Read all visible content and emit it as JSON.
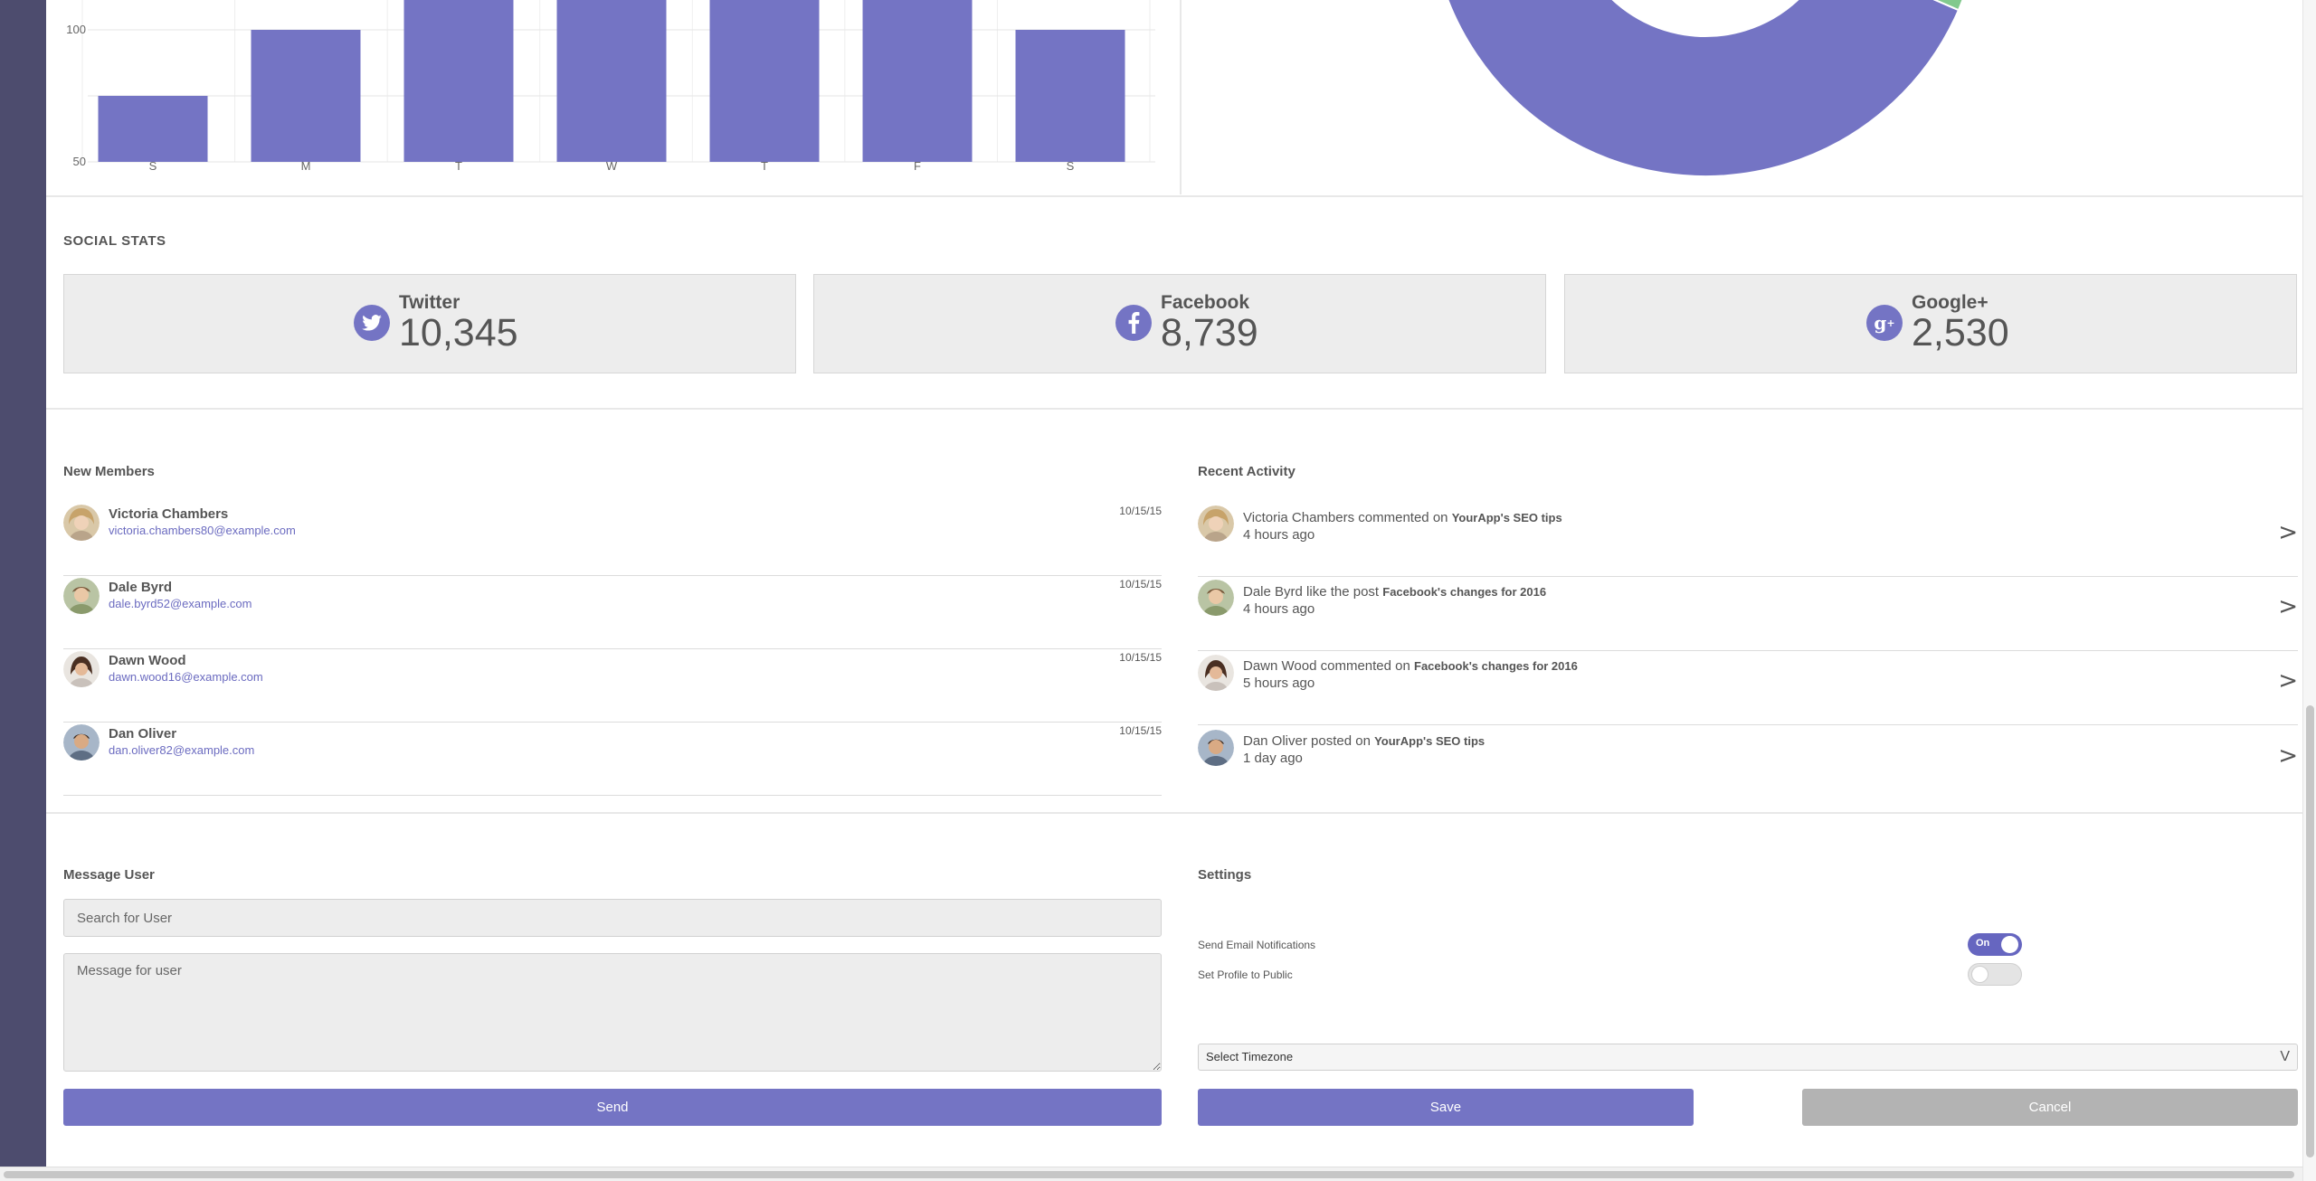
{
  "colors": {
    "accent": "#7474c4",
    "donut_green": "#82c98e",
    "sidebar": "#4d4c6e"
  },
  "chart_data": [
    {
      "type": "bar",
      "categories": [
        "S",
        "M",
        "T",
        "W",
        "T",
        "F",
        "S"
      ],
      "values": [
        75,
        100,
        125,
        125,
        125,
        125,
        100
      ],
      "ylim": [
        50,
        130
      ],
      "y_ticks": [
        "50",
        "100"
      ],
      "grid": true
    },
    {
      "type": "pie",
      "variant": "donut",
      "slices": [
        {
          "name": "",
          "value": 55,
          "color": "#7474c4"
        },
        {
          "name": "",
          "value": 45,
          "color": "#82c98e"
        }
      ],
      "partially_visible": true
    }
  ],
  "social": {
    "title": "SOCIAL STATS",
    "cards": [
      {
        "label": "Twitter",
        "value": "10,345",
        "icon": "twitter-icon"
      },
      {
        "label": "Facebook",
        "value": "8,739",
        "icon": "facebook-icon"
      },
      {
        "label": "Google+",
        "value": "2,530",
        "icon": "google-plus-icon"
      }
    ]
  },
  "members": {
    "title": "New Members",
    "items": [
      {
        "name": "Victoria Chambers",
        "email": "victoria.chambers80@example.com",
        "date": "10/15/15"
      },
      {
        "name": "Dale Byrd",
        "email": "dale.byrd52@example.com",
        "date": "10/15/15"
      },
      {
        "name": "Dawn Wood",
        "email": "dawn.wood16@example.com",
        "date": "10/15/15"
      },
      {
        "name": "Dan Oliver",
        "email": "dan.oliver82@example.com",
        "date": "10/15/15"
      }
    ]
  },
  "activity": {
    "title": "Recent Activity",
    "items": [
      {
        "actor": "Victoria Chambers",
        "action": "commented on",
        "target": "YourApp's SEO tips",
        "time": "4 hours ago"
      },
      {
        "actor": "Dale Byrd",
        "action": "like the post",
        "target": "Facebook's changes for 2016",
        "time": "4 hours ago"
      },
      {
        "actor": "Dawn Wood",
        "action": "commented on",
        "target": "Facebook's changes for 2016",
        "time": "5 hours ago"
      },
      {
        "actor": "Dan Oliver",
        "action": "posted on",
        "target": "YourApp's SEO tips",
        "time": "1 day ago"
      }
    ]
  },
  "message": {
    "title": "Message User",
    "search_placeholder": "Search for User",
    "message_placeholder": "Message for user",
    "send_label": "Send"
  },
  "settings": {
    "title": "Settings",
    "email_notifications": {
      "label": "Send Email Notifications",
      "state": "On"
    },
    "public_profile": {
      "label": "Set Profile to Public"
    },
    "timezone_placeholder": "Select Timezone",
    "timezone_arrow": "V",
    "save_label": "Save",
    "cancel_label": "Cancel"
  },
  "chevron": ">"
}
